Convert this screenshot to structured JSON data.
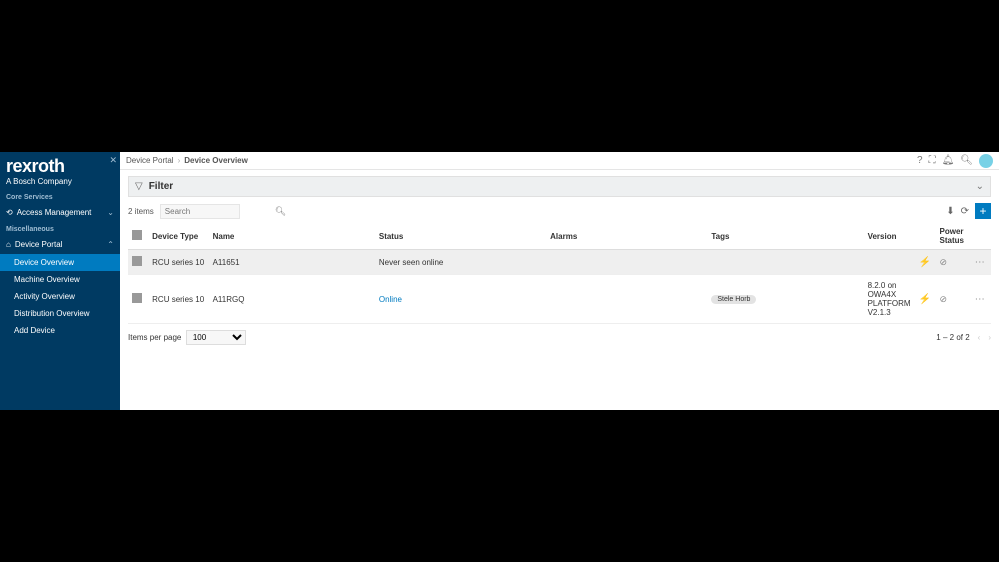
{
  "brand": {
    "logo": "rexroth",
    "sub": "A Bosch Company"
  },
  "sidebar": {
    "coreServicesTitle": "Core Services",
    "accessManagement": "Access Management",
    "miscTitle": "Miscellaneous",
    "devicePortal": "Device Portal",
    "subs": {
      "deviceOverview": "Device Overview",
      "machineOverview": "Machine Overview",
      "activityOverview": "Activity Overview",
      "distributionOverview": "Distribution Overview",
      "addDevice": "Add Device"
    }
  },
  "breadcrumb": {
    "root": "Device Portal",
    "current": "Device Overview"
  },
  "filter": {
    "label": "Filter"
  },
  "toolbar": {
    "itemsCount": "2 items",
    "searchPlaceholder": "Search"
  },
  "columns": {
    "deviceType": "Device Type",
    "name": "Name",
    "status": "Status",
    "alarms": "Alarms",
    "tags": "Tags",
    "version": "Version",
    "powerStatus": "Power Status"
  },
  "rows": [
    {
      "deviceType": "RCU series 10",
      "name": "A11651",
      "status": "Never seen online",
      "statusLink": false,
      "alarms": "",
      "tag": "",
      "version": "",
      "power": "⊘"
    },
    {
      "deviceType": "RCU series 10",
      "name": "A11RGQ",
      "status": "Online",
      "statusLink": true,
      "alarms": "",
      "tag": "Stele Horb",
      "version": "8.2.0 on OWA4X PLATFORM V2.1.3",
      "power": "⊘"
    }
  ],
  "pager": {
    "itemsPerPageLabel": "Items per page",
    "perPage": "100",
    "range": "1 – 2 of 2"
  }
}
